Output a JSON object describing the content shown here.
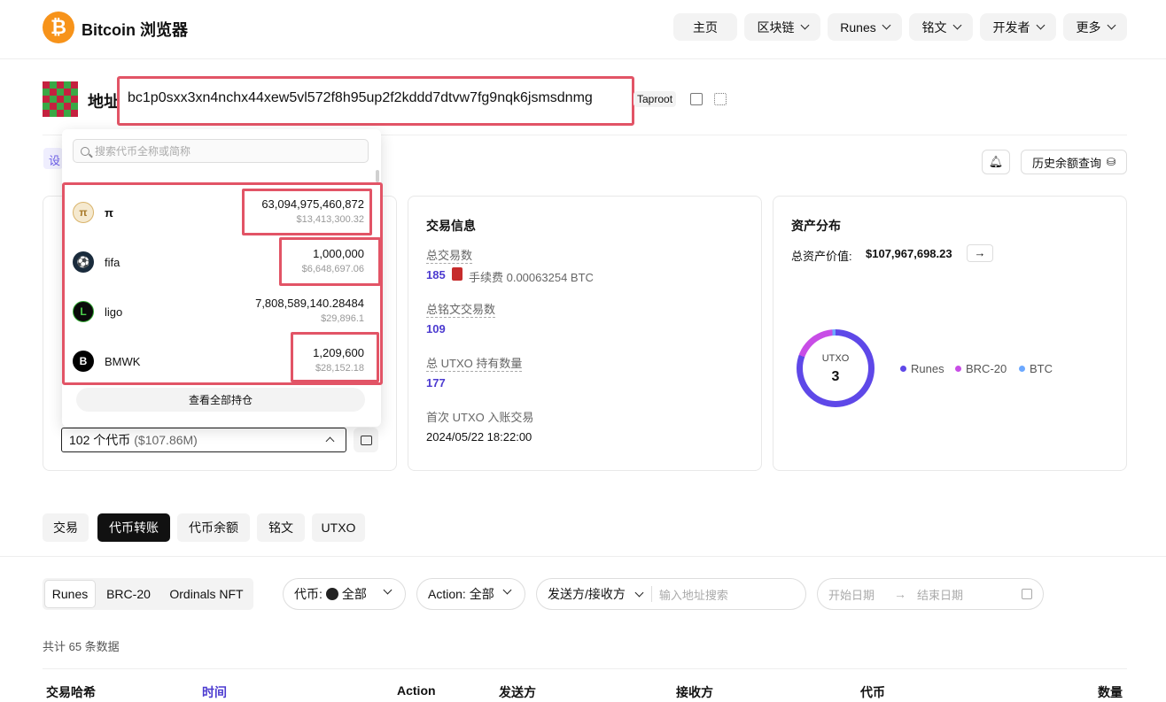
{
  "header": {
    "brand": "Bitcoin 浏览器",
    "logo_glyph": "₿",
    "nav": [
      {
        "label": "主页",
        "dropdown": false
      },
      {
        "label": "区块链",
        "dropdown": true
      },
      {
        "label": "Runes",
        "dropdown": true
      },
      {
        "label": "铭文",
        "dropdown": true
      },
      {
        "label": "开发者",
        "dropdown": true
      },
      {
        "label": "更多",
        "dropdown": true
      }
    ]
  },
  "address": {
    "label": "地址",
    "value": "bc1p0sxx3xn4nchx44xew5vl572f8h95up2f2kddd7dtvw7fg9nqk6jsmsdnmg",
    "type_tag": "Taproot"
  },
  "settings_chip": "设",
  "actions": {
    "history_label": "历史余额查询"
  },
  "token_dropdown": {
    "search_placeholder": "搜索代币全称或简称",
    "items": [
      {
        "icon": "π",
        "name": "π",
        "amount": "63,094,975,460,872",
        "usd": "$13,413,300.32"
      },
      {
        "icon": "⚽",
        "name": "fifa",
        "amount": "1,000,000",
        "usd": "$6,648,697.06"
      },
      {
        "icon": "L",
        "name": "ligo",
        "amount": "7,808,589,140.28484",
        "usd": "$29,896.1"
      },
      {
        "icon": "B",
        "name": "BMWK",
        "amount": "1,209,600",
        "usd": "$28,152.18"
      }
    ],
    "view_all": "查看全部持仓",
    "select_value": "102 个代币 ",
    "select_usd": "($107.86M)"
  },
  "tx_info": {
    "title": "交易信息",
    "total_tx_label": "总交易数",
    "total_tx_value": "185",
    "fee_text": "手续费 0.00063254 BTC",
    "inscription_label": "总铭文交易数",
    "inscription_value": "109",
    "utxo_label": "总 UTXO 持有数量",
    "utxo_value": "177",
    "first_utxo_label": "首次 UTXO 入账交易",
    "first_utxo_value": "2024/05/22 18:22:00"
  },
  "assets": {
    "title": "资产分布",
    "total_label": "总资产价值:",
    "total_value": "$107,967,698.23",
    "donut_label": "UTXO",
    "donut_value": "3",
    "legend": [
      {
        "name": "Runes",
        "color": "#5e48e8"
      },
      {
        "name": "BRC-20",
        "color": "#c84de6"
      },
      {
        "name": "BTC",
        "color": "#6ca8ff"
      }
    ]
  },
  "tabs": [
    "交易",
    "代币转账",
    "代币余额",
    "铭文",
    "UTXO"
  ],
  "filters": {
    "segments": [
      "Runes",
      "BRC-20",
      "Ordinals NFT"
    ],
    "token_label": "代币:",
    "token_value": "全部",
    "action_label": "Action: 全部",
    "party_label": "发送方/接收方",
    "party_placeholder": "输入地址搜索",
    "start_date": "开始日期",
    "end_date": "结束日期"
  },
  "table": {
    "total": "共计 65 条数据",
    "headers": [
      "交易哈希",
      "时间",
      "Action",
      "发送方",
      "接收方",
      "代币",
      "数量"
    ]
  }
}
